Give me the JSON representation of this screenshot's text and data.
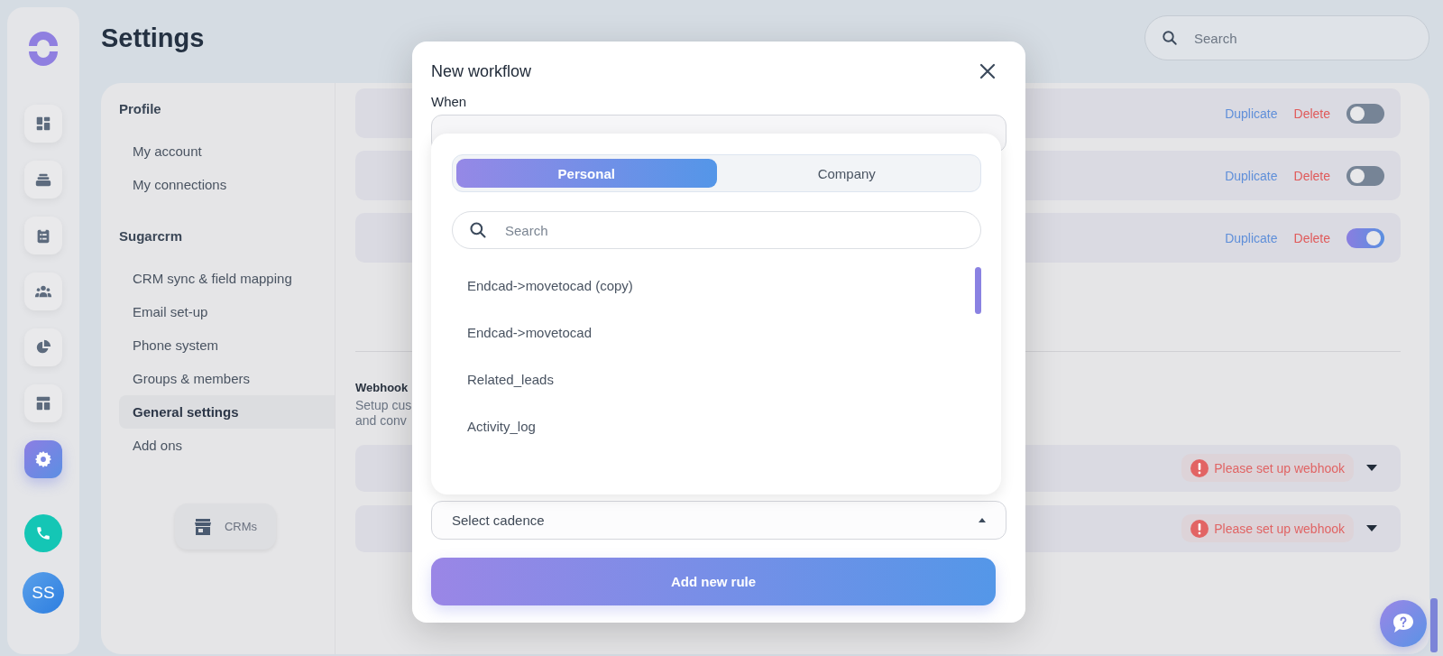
{
  "page_title": "Settings",
  "search": {
    "placeholder": "Search"
  },
  "rail": [
    {
      "selected": false
    },
    {
      "selected": false
    },
    {
      "selected": false
    },
    {
      "selected": false
    },
    {
      "selected": false
    },
    {
      "selected": false
    },
    {
      "selected": true
    }
  ],
  "avatar": "SS",
  "nav": [
    {
      "heading": "Profile",
      "items": [
        {
          "label": "My account",
          "selected": false
        },
        {
          "label": "My connections",
          "selected": false
        }
      ]
    },
    {
      "heading": "Sugarcrm",
      "items": [
        {
          "label": "CRM sync & field mapping",
          "selected": false
        },
        {
          "label": "Email set-up",
          "selected": false
        },
        {
          "label": "Phone system",
          "selected": false
        },
        {
          "label": "Groups & members",
          "selected": false
        },
        {
          "label": "General settings",
          "selected": true
        },
        {
          "label": "Add ons",
          "selected": false
        }
      ]
    }
  ],
  "crms_button": "CRMs",
  "rules": [
    {
      "duplicate": "Duplicate",
      "delete": "Delete",
      "on": false
    },
    {
      "duplicate": "Duplicate",
      "delete": "Delete",
      "on": false
    },
    {
      "duplicate": "Duplicate",
      "delete": "Delete",
      "on": true
    }
  ],
  "webhook": {
    "title": "Webhook",
    "description": "Setup cus\nand conv",
    "rows": [
      {
        "status": "Please set up webhook"
      },
      {
        "status": "Please set up webhook"
      }
    ]
  },
  "modal": {
    "title": "New workflow",
    "when_label": "When",
    "dropdown": {
      "tabs": [
        {
          "label": "Personal",
          "selected": true
        },
        {
          "label": "Company",
          "selected": false
        }
      ],
      "search_placeholder": "Search",
      "items": [
        "Endcad->movetocad (copy)",
        "Endcad->movetocad",
        "Related_leads",
        "Activity_log"
      ]
    },
    "cadence_placeholder": "Select cadence",
    "submit": "Add new rule"
  }
}
